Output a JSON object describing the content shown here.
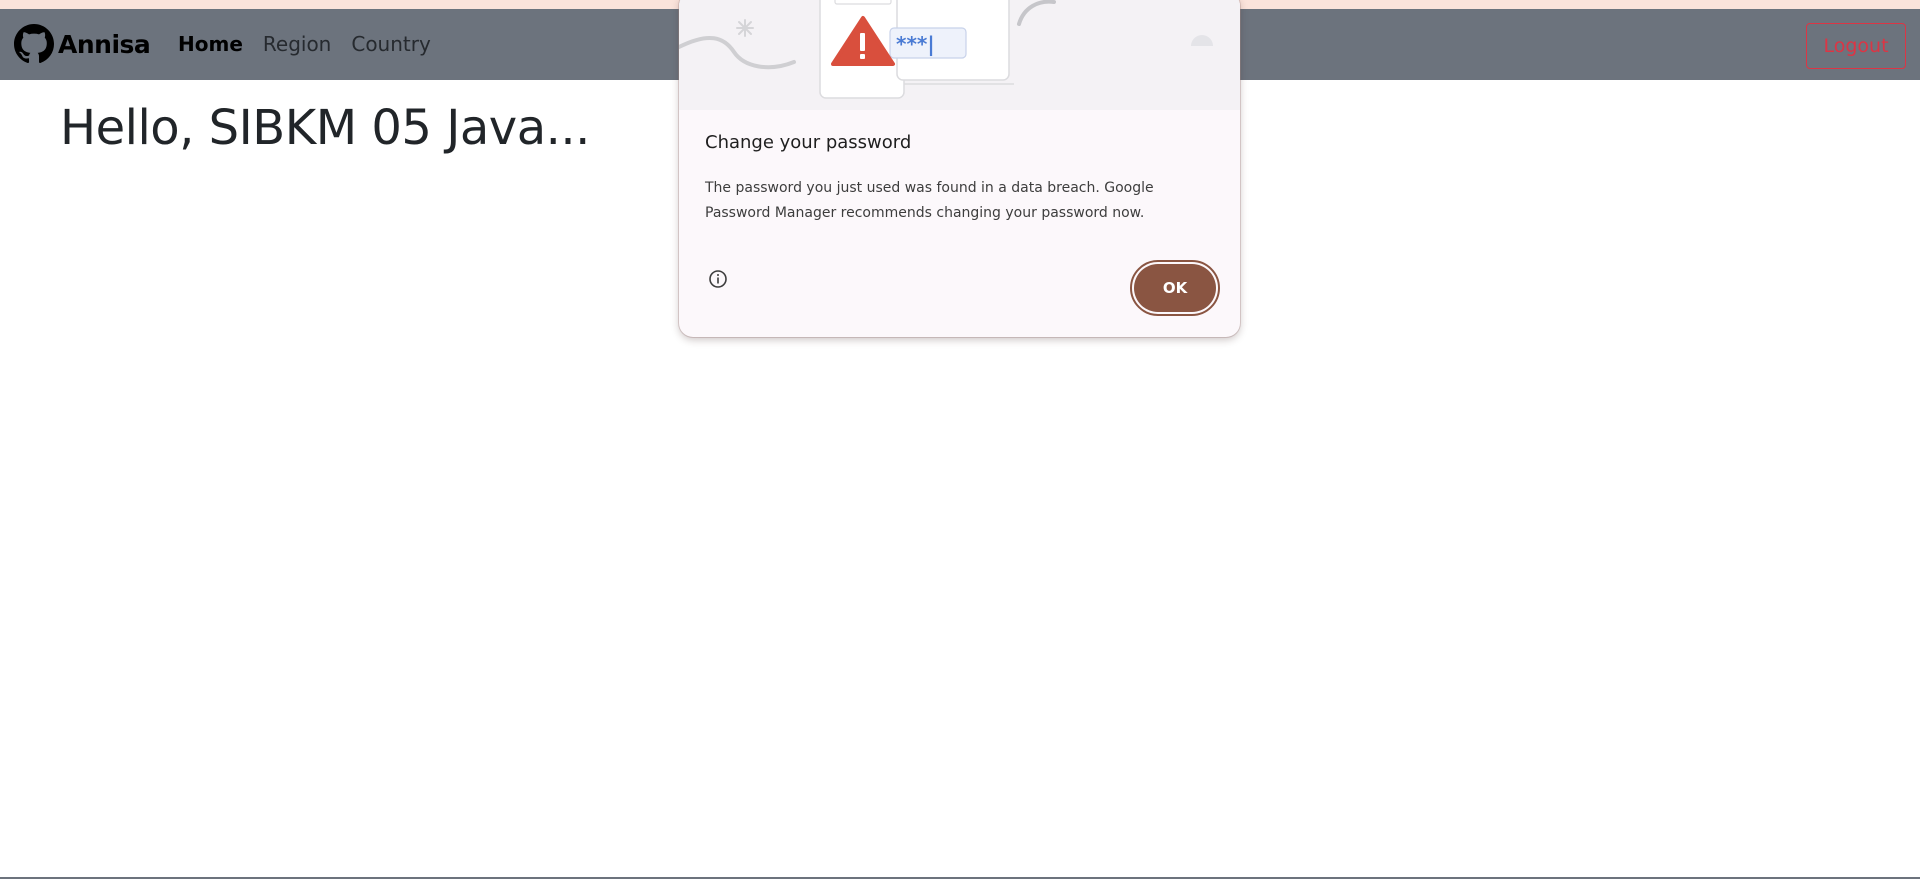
{
  "navbar": {
    "brand": "Annisa",
    "links": [
      {
        "label": "Home",
        "active": true
      },
      {
        "label": "Region",
        "active": false
      },
      {
        "label": "Country",
        "active": false
      }
    ],
    "logout_label": "Logout"
  },
  "main": {
    "heading": "Hello, SIBKM 05 Java..."
  },
  "dialog": {
    "title": "Change your password",
    "body": "The password you just used was found in a data breach. Google Password Manager recommends changing your password now.",
    "ok_label": "OK",
    "illustration_text": "***|"
  },
  "colors": {
    "navbar_bg": "#6c737d",
    "top_strip": "#fbe3db",
    "logout": "#dc3545",
    "ok_button": "#8a5542",
    "warning": "#d94f3d",
    "password_dots": "#4a7bd4"
  },
  "icons": {
    "brand": "github-icon",
    "info": "info-icon",
    "warning": "warning-triangle-icon"
  }
}
